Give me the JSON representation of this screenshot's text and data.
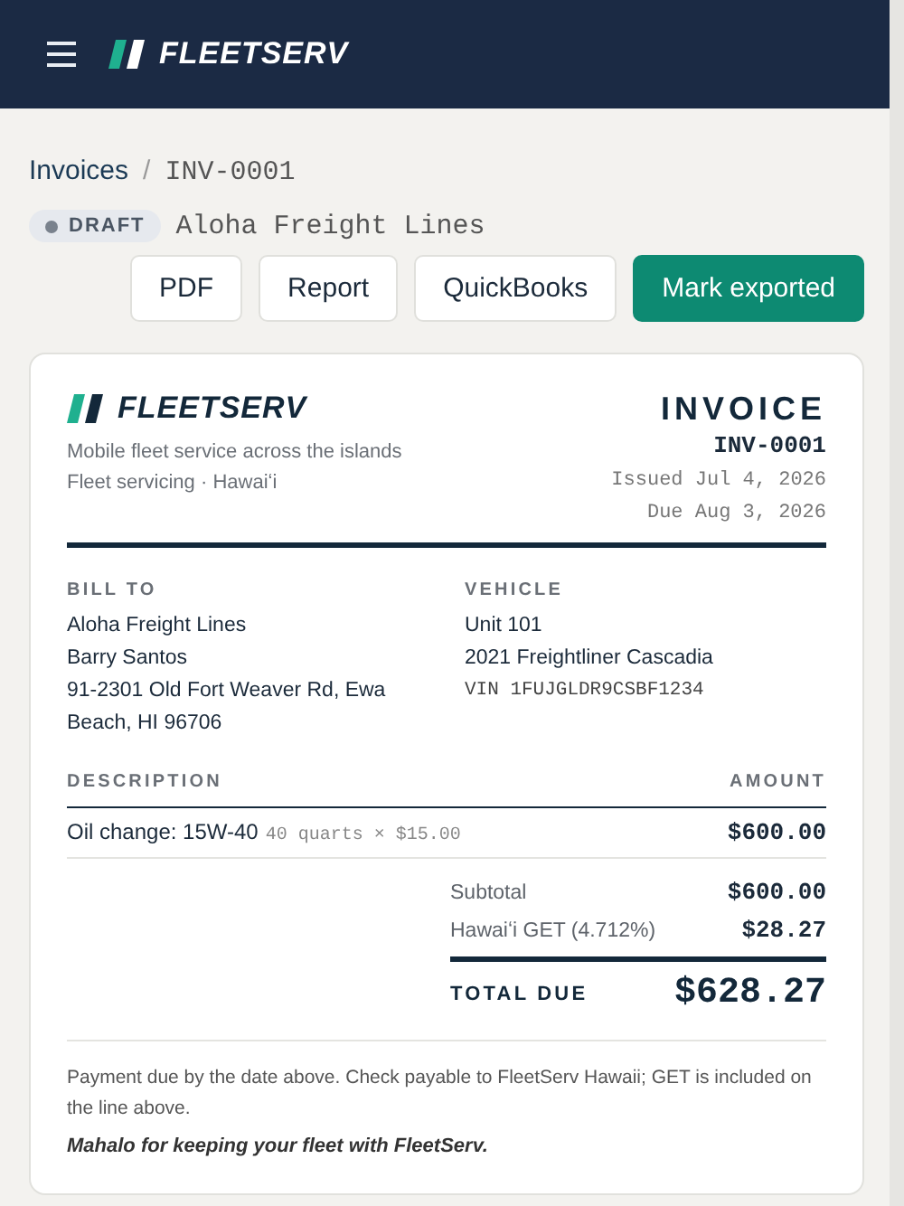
{
  "header": {
    "brand": "FLEETSERV"
  },
  "breadcrumb": [
    {
      "label": "Invoices",
      "kind": "link"
    },
    {
      "label": "/",
      "kind": "separator"
    },
    {
      "label": "INV-0001",
      "kind": "current"
    }
  ],
  "status": {
    "label": "DRAFT",
    "kind": "draft",
    "customer": "Aloha Freight Lines"
  },
  "actions": [
    {
      "label": "PDF",
      "kind": "secondary"
    },
    {
      "label": "Report",
      "kind": "secondary"
    },
    {
      "label": "QuickBooks",
      "kind": "secondary"
    },
    {
      "label": "Mark exported",
      "kind": "primary"
    }
  ],
  "invoice": {
    "brand": "FLEETSERV",
    "tagline": "Mobile fleet service across the islands",
    "subline": "Fleet servicing · Hawaiʻi",
    "title": "INVOICE",
    "number": "INV-0001",
    "issued": "Issued Jul 4, 2026",
    "due": "Due Aug 3, 2026",
    "bill_to": {
      "heading": "BILL TO",
      "lines": [
        "Aloha Freight Lines",
        "Barry Santos",
        "91-2301 Old Fort Weaver Rd, Ewa Beach, HI 96706"
      ]
    },
    "vehicle": {
      "heading": "VEHICLE",
      "lines": [
        "Unit 101",
        "2021 Freightliner Cascadia"
      ],
      "vin": "VIN 1FUJGLDR9CSBF1234"
    },
    "columns": [
      "DESCRIPTION",
      "AMOUNT"
    ],
    "items": [
      {
        "description": "Oil change: 15W-40",
        "detail": "40 quarts × $15.00",
        "amount": "$600.00"
      }
    ],
    "totals": [
      {
        "label": "Subtotal",
        "value": "$600.00"
      },
      {
        "label": "Hawaiʻi GET (4.712%)",
        "value": "$28.27"
      }
    ],
    "total": {
      "label": "TOTAL DUE",
      "value": "$628.27"
    },
    "note": "Payment due by the date above. Check payable to FleetServ Hawaii; GET is included on the line above.",
    "thanks": "Mahalo for keeping your fleet with FleetServ."
  }
}
